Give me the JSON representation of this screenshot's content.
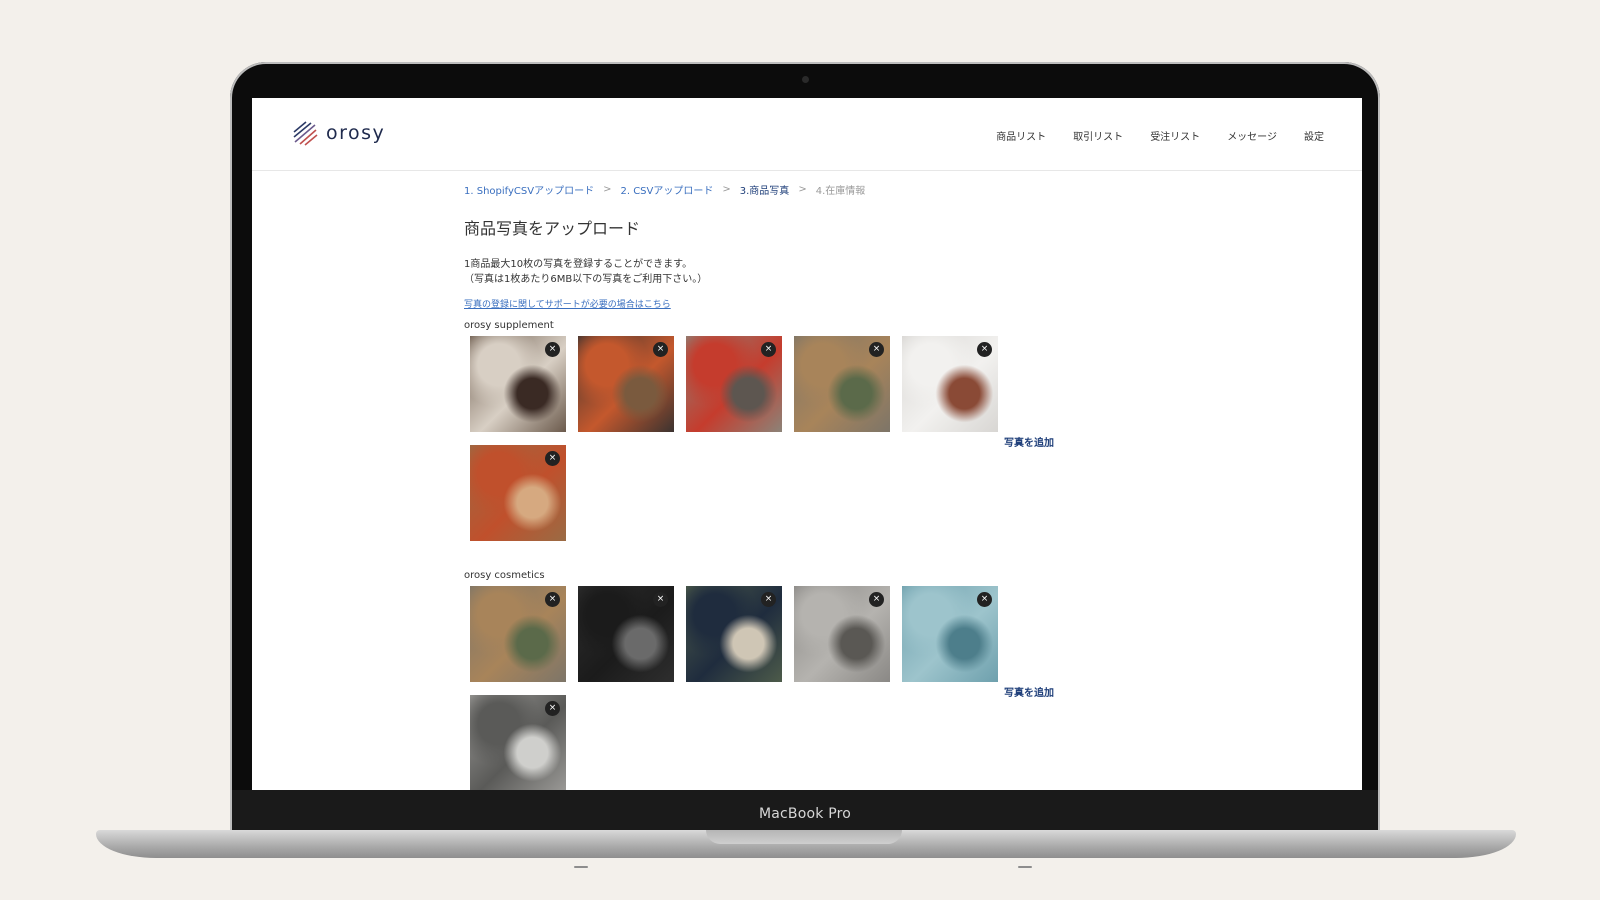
{
  "device": {
    "label": "MacBook Pro"
  },
  "header": {
    "logo_text": "orosy",
    "nav": [
      "商品リスト",
      "取引リスト",
      "受注リスト",
      "メッセージ",
      "設定"
    ]
  },
  "breadcrumb": [
    {
      "label": "1. ShopifyCSVアップロード",
      "state": "done"
    },
    {
      "label": "2. CSVアップロード",
      "state": "done"
    },
    {
      "label": "3.商品写真",
      "state": "current"
    },
    {
      "label": "4.在庫情報",
      "state": "pending"
    }
  ],
  "breadcrumb_separator": ">",
  "page": {
    "title": "商品写真をアップロード",
    "desc_line1": "1商品最大10枚の写真を登録することができます。",
    "desc_line2": "（写真は1枚あたり6MB以下の写真をご利用下さい。）",
    "help_link": "写真の登録に関してサポートが必要の場合はこちら"
  },
  "close_glyph": "×",
  "groups": [
    {
      "name": "orosy supplement",
      "add_label": "写真を追加",
      "photos": [
        {
          "colors": [
            "#6b5a4c",
            "#d8cfc4",
            "#3a2a24"
          ]
        },
        {
          "colors": [
            "#3b3330",
            "#c4582d",
            "#7a5a3e"
          ]
        },
        {
          "colors": [
            "#8c8378",
            "#c53c2d",
            "#5d5650"
          ]
        },
        {
          "colors": [
            "#7d7568",
            "#a8845a",
            "#5b6a4a"
          ]
        },
        {
          "colors": [
            "#d8d6d3",
            "#f2f1ef",
            "#8a4a36"
          ]
        },
        {
          "colors": [
            "#9a6b44",
            "#c0502c",
            "#d6a980"
          ]
        }
      ]
    },
    {
      "name": "orosy cosmetics",
      "add_label": "写真を追加",
      "photos": [
        {
          "colors": [
            "#7d7568",
            "#a8845a",
            "#5b6a4a"
          ]
        },
        {
          "colors": [
            "#2e2e2e",
            "#1b1b1b",
            "#6a6a6a"
          ]
        },
        {
          "colors": [
            "#4d5b4a",
            "#1f2c3e",
            "#cfc6b5"
          ]
        },
        {
          "colors": [
            "#8a8885",
            "#b5b3af",
            "#5a5854"
          ]
        },
        {
          "colors": [
            "#6ea0ad",
            "#9dc4cc",
            "#4d7e8b"
          ]
        },
        {
          "colors": [
            "#9a9996",
            "#5a5a58",
            "#cfcfcc"
          ]
        }
      ]
    }
  ]
}
